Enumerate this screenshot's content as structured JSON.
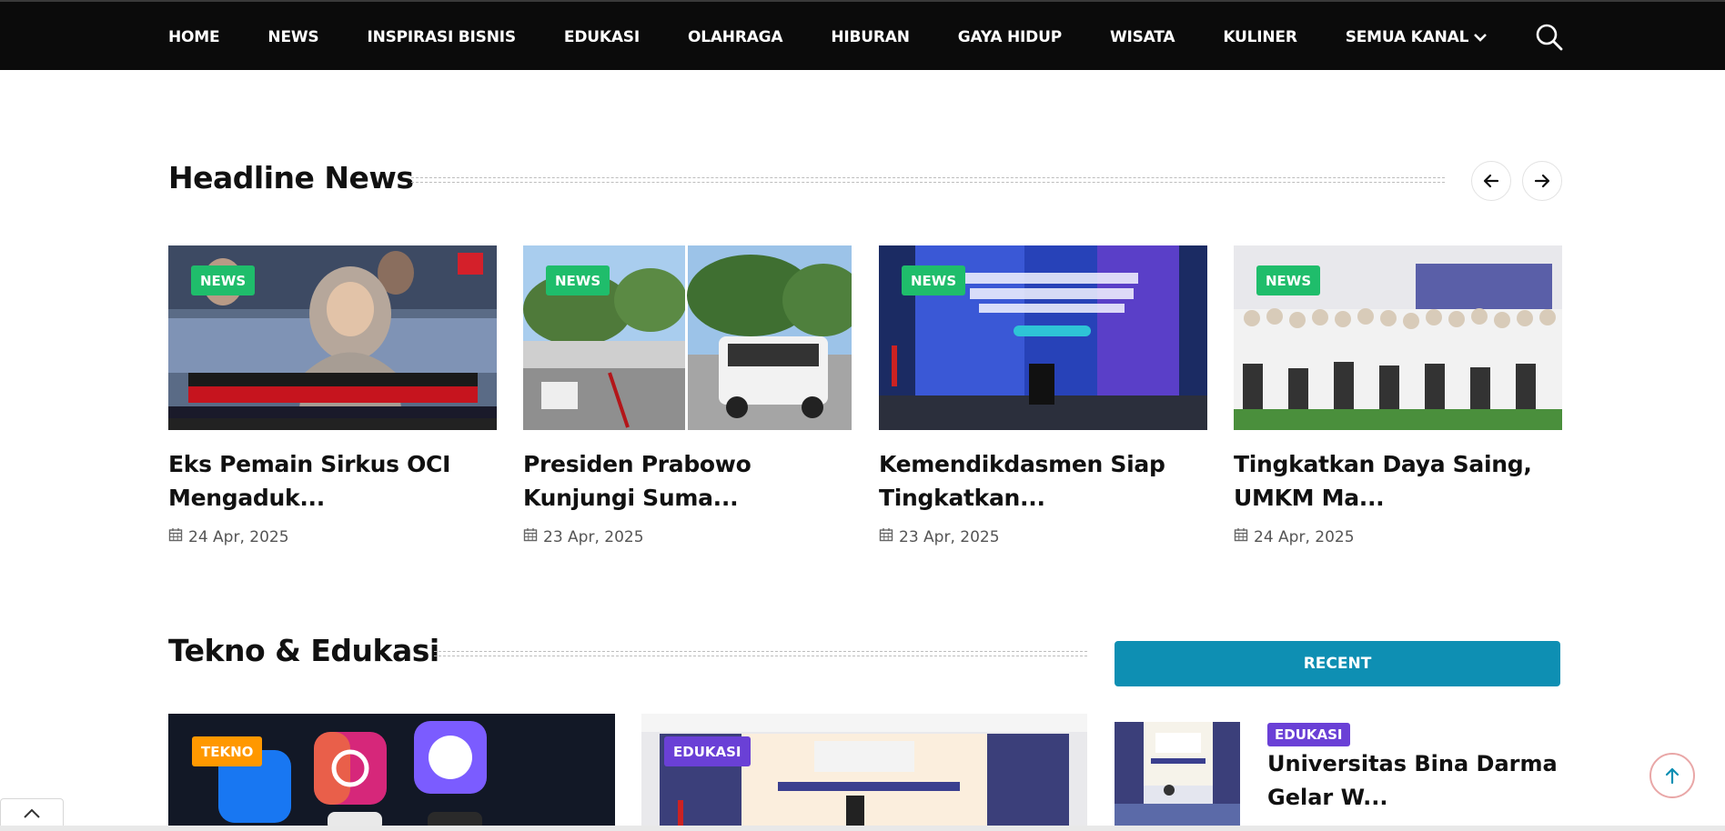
{
  "nav": {
    "items": [
      "HOME",
      "NEWS",
      "INSPIRASI BISNIS",
      "EDUKASI",
      "OLAHRAGA",
      "HIBURAN",
      "GAYA HIDUP",
      "WISATA",
      "KULINER",
      "SEMUA KANAL"
    ]
  },
  "headline": {
    "title": "Headline News",
    "cards": [
      {
        "badge": "NEWS",
        "title": "Eks Pemain Sirkus OCI Mengaduk...",
        "date": "24 Apr, 2025"
      },
      {
        "badge": "NEWS",
        "title": "Presiden Prabowo Kunjungi Suma...",
        "date": "23 Apr, 2025"
      },
      {
        "badge": "NEWS",
        "title": "Kemendikdasmen Siap Tingkatkan...",
        "date": "23 Apr, 2025"
      },
      {
        "badge": "NEWS",
        "title": "Tingkatkan Daya Saing, UMKM Ma...",
        "date": "24 Apr, 2025"
      }
    ]
  },
  "tekno": {
    "title": "Tekno & Edukasi",
    "cards": [
      {
        "badge": "TEKNO"
      },
      {
        "badge": "EDUKASI"
      }
    ]
  },
  "recent": {
    "button_label": "RECENT",
    "item": {
      "badge": "EDUKASI",
      "title": "Universitas Bina Darma Gelar W..."
    }
  },
  "colors": {
    "nav_bg": "#0b0b0b",
    "news_badge": "#1fbd6b",
    "tekno_badge": "#ff9800",
    "edukasi_badge": "#6a40d6",
    "recent_button": "#0e8fb3"
  },
  "icons": {
    "search": "search-icon",
    "prev": "arrow-left-icon",
    "next": "arrow-right-icon",
    "date": "calendar-icon",
    "nav_dropdown": "chevron-down-icon",
    "to_top": "arrow-up-icon",
    "collapse": "chevron-up-icon"
  }
}
